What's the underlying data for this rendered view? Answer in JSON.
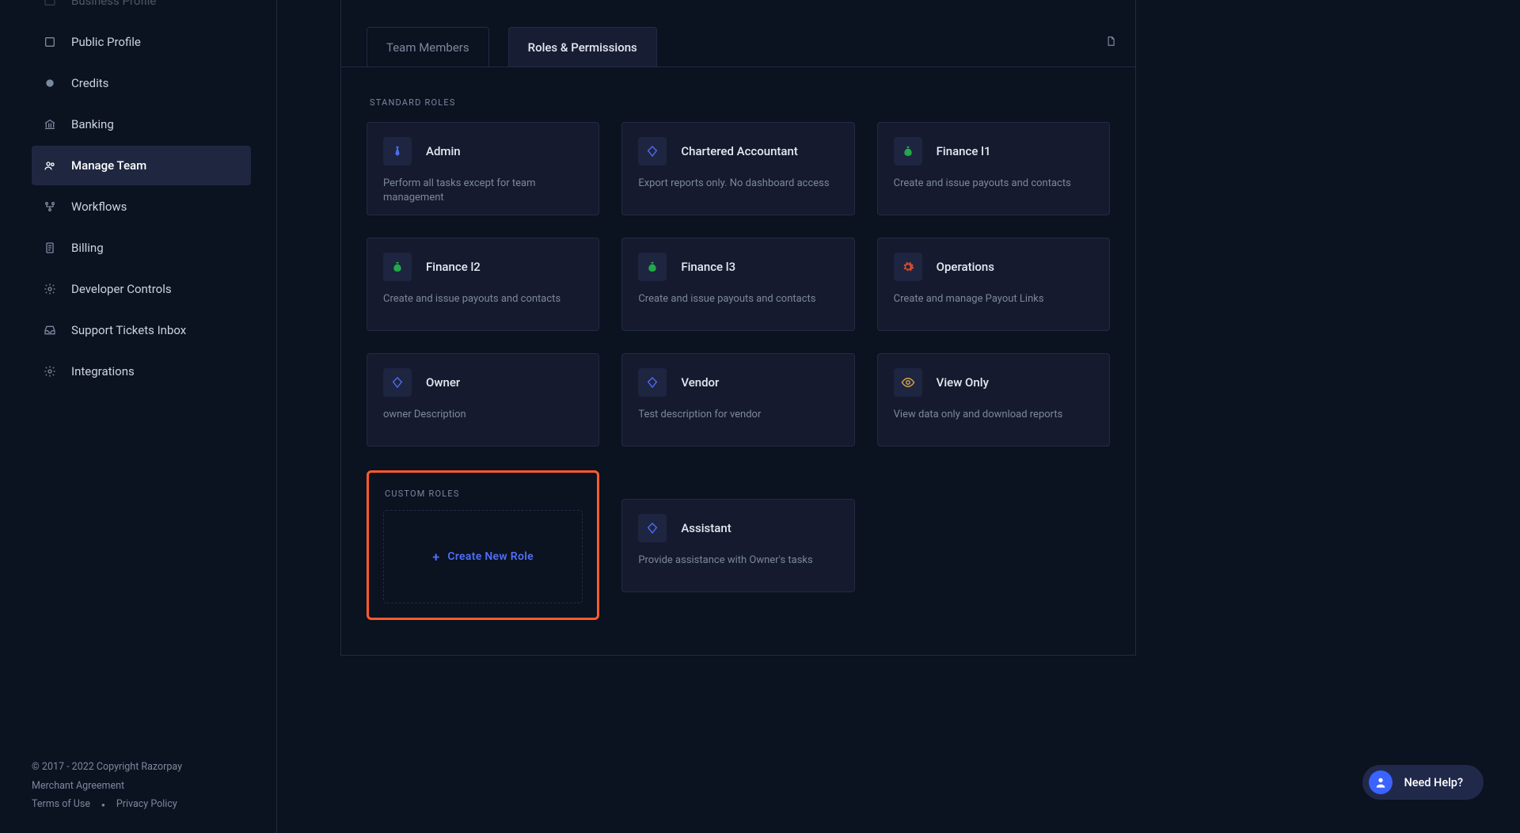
{
  "sidebar": {
    "items": [
      {
        "label": "Business Profile"
      },
      {
        "label": "Public Profile"
      },
      {
        "label": "Credits"
      },
      {
        "label": "Banking"
      },
      {
        "label": "Manage Team"
      },
      {
        "label": "Workflows"
      },
      {
        "label": "Billing"
      },
      {
        "label": "Developer Controls"
      },
      {
        "label": "Support Tickets Inbox"
      },
      {
        "label": "Integrations"
      }
    ],
    "footer": {
      "copyright": "© 2017 - 2022 Copyright Razorpay",
      "merchant": "Merchant Agreement",
      "terms": "Terms of Use",
      "privacy": "Privacy Policy"
    }
  },
  "tabs": {
    "team_members": "Team Members",
    "roles_permissions": "Roles & Permissions"
  },
  "sections": {
    "standard": "STANDARD ROLES",
    "custom": "CUSTOM ROLES"
  },
  "roles": {
    "admin": {
      "title": "Admin",
      "desc": "Perform all tasks except for team management"
    },
    "chartered": {
      "title": "Chartered Accountant",
      "desc": "Export reports only. No dashboard access"
    },
    "finance1": {
      "title": "Finance l1",
      "desc": "Create and issue payouts and contacts"
    },
    "finance2": {
      "title": "Finance l2",
      "desc": "Create and issue payouts and contacts"
    },
    "finance3": {
      "title": "Finance l3",
      "desc": "Create and issue payouts and contacts"
    },
    "operations": {
      "title": "Operations",
      "desc": "Create and manage Payout Links"
    },
    "owner": {
      "title": "Owner",
      "desc": "owner Description"
    },
    "vendor": {
      "title": "Vendor",
      "desc": "Test description for vendor"
    },
    "viewonly": {
      "title": "View Only",
      "desc": "View data only and download reports"
    },
    "assistant": {
      "title": "Assistant",
      "desc": "Provide assistance with Owner's tasks"
    }
  },
  "create_role": "Create New Role",
  "need_help": "Need Help?",
  "colors": {
    "accent_blue": "#4f6ef7",
    "highlight_orange": "#ff5a2b",
    "icon_green": "#23a94a"
  }
}
